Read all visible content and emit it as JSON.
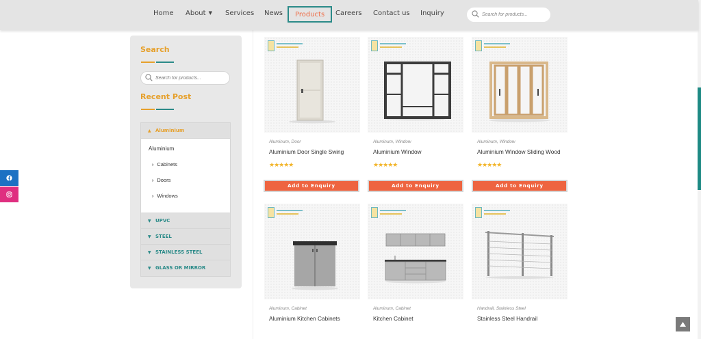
{
  "nav": {
    "items": [
      "Home",
      "About",
      "Services",
      "News",
      "Products",
      "Careers",
      "Contact us",
      "Inquiry"
    ],
    "active": "Products",
    "search_placeholder": "Search for products..."
  },
  "social": {
    "facebook_icon": "facebook-icon",
    "instagram_icon": "instagram-icon"
  },
  "sidebar": {
    "search_title": "Search",
    "search_placeholder": "Search for products...",
    "recent_title": "Recent Post",
    "accordion": {
      "open": {
        "label": "Aluminium",
        "parent": "Aluminium",
        "children": [
          "Cabinets",
          "Doors",
          "Windows"
        ]
      },
      "closed": [
        "UPVC",
        "STEEL",
        "STAINLESS STEEL",
        "GLASS OR MIRROR"
      ]
    }
  },
  "products": [
    {
      "category": "Aluminum, Door",
      "name": "Aluminium Door Single Swing",
      "rating": 5,
      "button": "Add to Enquiry"
    },
    {
      "category": "Aluminum, Window",
      "name": "Aluminium Window",
      "rating": 5,
      "button": "Add to Enquiry"
    },
    {
      "category": "Aluminum, Window",
      "name": "Aluminium Window Sliding Wood",
      "rating": 5,
      "button": "Add to Enquiry"
    },
    {
      "category": "Aluminum, Cabinet",
      "name": "Aluminium Kitchen Cabinets"
    },
    {
      "category": "Aluminum, Cabinet",
      "name": "Kitchen Cabinet"
    },
    {
      "category": "Handrail, Stainless Steel",
      "name": "Stainless Steel Handrail"
    }
  ],
  "colors": {
    "accent_orange": "#ee6440",
    "heading_gold": "#e6a02b",
    "teal": "#2a8a88",
    "facebook": "#1c71c3",
    "instagram": "#df2f80",
    "star": "#f2b52b"
  }
}
